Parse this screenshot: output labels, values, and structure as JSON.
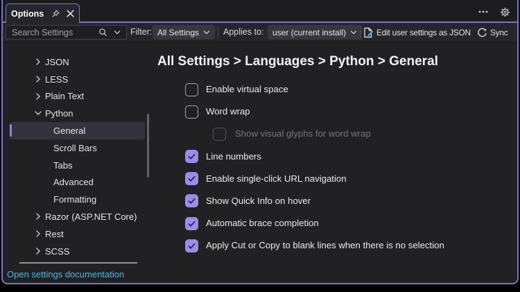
{
  "window": {
    "tab_title": "Options",
    "icons": {
      "pin": "pin-icon",
      "close": "close-icon",
      "overflow": "ellipsis-icon",
      "settings": "gear-icon"
    }
  },
  "toolbar": {
    "search_placeholder": "Search Settings",
    "filter_label": "Filter:",
    "filter_value": "All Settings",
    "applies_label": "Applies to:",
    "applies_value": "user (current install)",
    "edit_json_label": "Edit user settings as JSON",
    "sync_label": "Sync"
  },
  "sidebar": {
    "items": [
      {
        "label": "JSON",
        "level": 0,
        "expanded": false
      },
      {
        "label": "LESS",
        "level": 0,
        "expanded": false
      },
      {
        "label": "Plain Text",
        "level": 0,
        "expanded": false
      },
      {
        "label": "Python",
        "level": 0,
        "expanded": true
      },
      {
        "label": "General",
        "level": 1,
        "selected": true
      },
      {
        "label": "Scroll Bars",
        "level": 1
      },
      {
        "label": "Tabs",
        "level": 1
      },
      {
        "label": "Advanced",
        "level": 1
      },
      {
        "label": "Formatting",
        "level": 1
      },
      {
        "label": "Razor (ASP.NET Core)",
        "level": 0,
        "expanded": false
      },
      {
        "label": "Rest",
        "level": 0,
        "expanded": false
      },
      {
        "label": "SCSS",
        "level": 0,
        "expanded": false
      }
    ],
    "footer_link": "Open settings documentation"
  },
  "content": {
    "heading": "All Settings > Languages > Python > General",
    "options": [
      {
        "label": "Enable virtual space",
        "checked": false,
        "indent": 0,
        "disabled": false
      },
      {
        "label": "Word wrap",
        "checked": false,
        "indent": 0,
        "disabled": false
      },
      {
        "label": "Show visual glyphs for word wrap",
        "checked": false,
        "indent": 1,
        "disabled": true
      },
      {
        "label": "Line numbers",
        "checked": true,
        "indent": 0,
        "disabled": false
      },
      {
        "label": "Enable single-click URL navigation",
        "checked": true,
        "indent": 0,
        "disabled": false
      },
      {
        "label": "Show Quick Info on hover",
        "checked": true,
        "indent": 0,
        "disabled": false
      },
      {
        "label": "Automatic brace completion",
        "checked": true,
        "indent": 0,
        "disabled": false
      },
      {
        "label": "Apply Cut or Copy to blank lines when there is no selection",
        "checked": true,
        "indent": 0,
        "disabled": false
      }
    ]
  },
  "colors": {
    "accent_border": "#7d75cd",
    "checkbox_checked": "#9b8cee",
    "link": "#49b8e9",
    "selection_bar": "#8f80e8"
  }
}
